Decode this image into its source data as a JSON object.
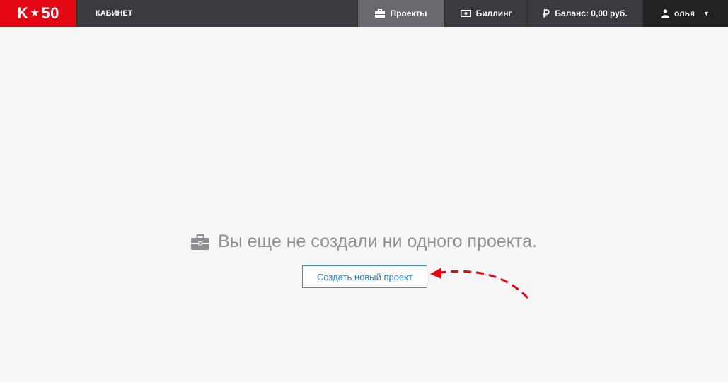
{
  "header": {
    "logo_left": "K",
    "logo_star": "★",
    "logo_right": "50",
    "section_title": "КАБИНЕТ",
    "nav": {
      "projects": "Проекты",
      "billing": "Биллинг",
      "balance": "Баланс: 0,00 руб.",
      "user": "олья"
    }
  },
  "main": {
    "empty_message": "Вы еще не создали ни одного проекта.",
    "create_button": "Создать новый проект"
  },
  "icons": {
    "projects": "briefcase-icon",
    "billing": "banknote-icon",
    "balance": "ruble-icon",
    "user": "user-icon",
    "empty": "briefcase-icon",
    "hint": "dashed-arrow-icon"
  },
  "colors": {
    "brand_red": "#e30613",
    "topbar": "#3b3b3f",
    "active_nav": "#6a6a6e",
    "user_nav": "#222225",
    "button_border": "#3a8fcb",
    "arrow": "#e30613"
  }
}
